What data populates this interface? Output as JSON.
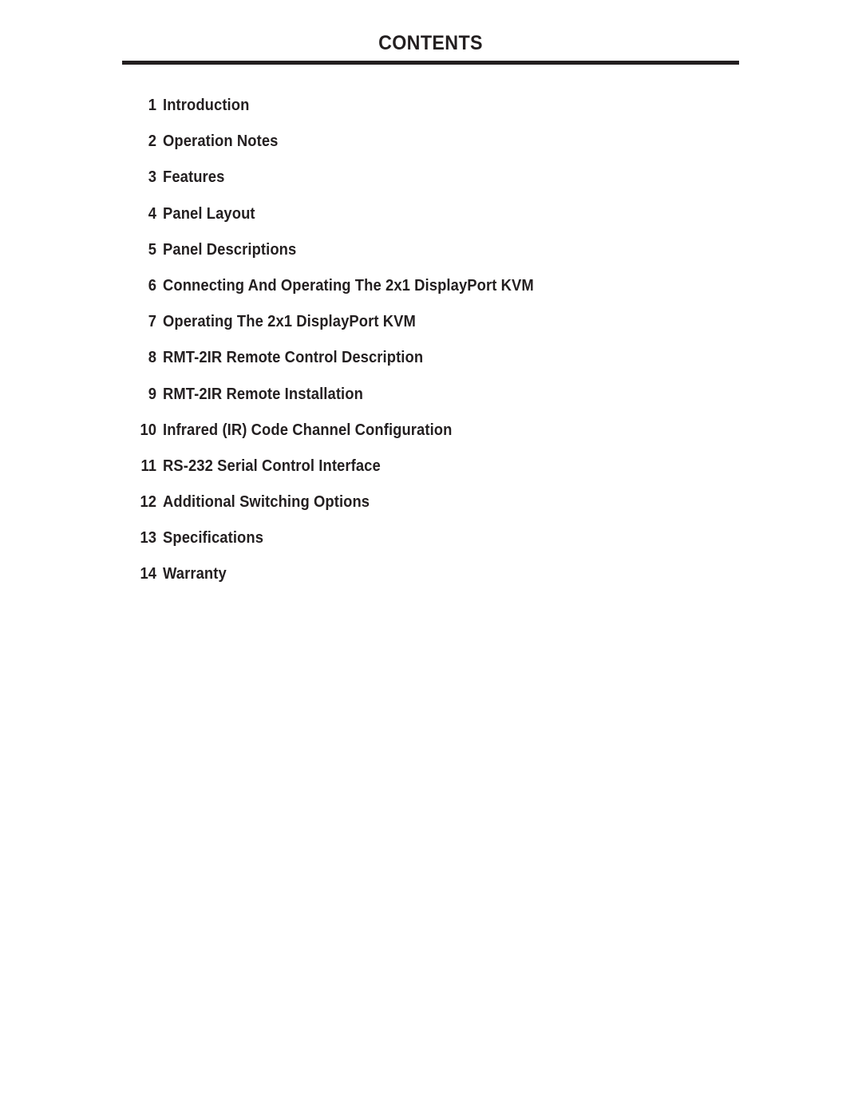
{
  "document": {
    "heading": "CONTENTS",
    "text_color": "#231f20",
    "background_color": "#ffffff"
  },
  "contents": {
    "entries": [
      {
        "number": "1",
        "title": "Introduction"
      },
      {
        "number": "2",
        "title": "Operation Notes"
      },
      {
        "number": "3",
        "title": "Features"
      },
      {
        "number": "4",
        "title": "Panel Layout"
      },
      {
        "number": "5",
        "title": "Panel Descriptions"
      },
      {
        "number": "6",
        "title": "Connecting And Operating The 2x1 DisplayPort KVM"
      },
      {
        "number": "7",
        "title": "Operating The 2x1 DisplayPort KVM"
      },
      {
        "number": "8",
        "title": "RMT-2IR Remote Control Description"
      },
      {
        "number": "9",
        "title": "RMT-2IR Remote Installation"
      },
      {
        "number": "10",
        "title": "Infrared (IR) Code Channel Configuration"
      },
      {
        "number": "11",
        "title": "RS-232 Serial Control Interface"
      },
      {
        "number": "12",
        "title": "Additional Switching Options"
      },
      {
        "number": "13",
        "title": "Specifications"
      },
      {
        "number": "14",
        "title": "Warranty"
      }
    ]
  }
}
